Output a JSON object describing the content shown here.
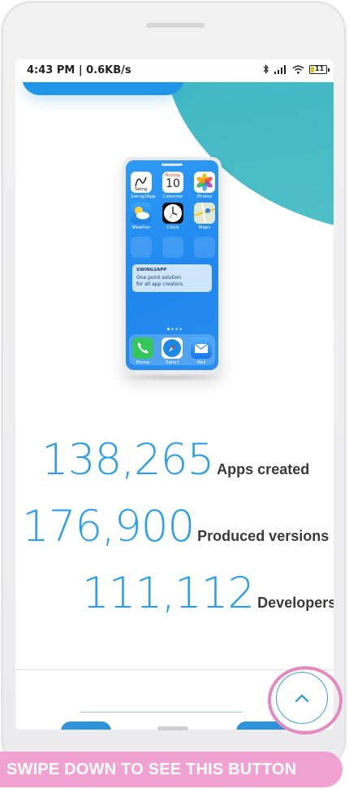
{
  "status_bar": {
    "time_speed": "4:43 PM | 0.6KB/s",
    "battery_level": "11"
  },
  "mini_phone": {
    "apps": [
      {
        "label": "Swing2App",
        "icon": "swing2app-icon"
      },
      {
        "label": "Calendar",
        "icon": "calendar-icon",
        "day": "Monday",
        "date": "10"
      },
      {
        "label": "Photos",
        "icon": "photos-icon"
      },
      {
        "label": "Weather",
        "icon": "weather-icon"
      },
      {
        "label": "Clock",
        "icon": "clock-icon"
      },
      {
        "label": "Maps",
        "icon": "maps-icon"
      }
    ],
    "widget": {
      "brand": "SWING2APP",
      "line1": "One point solution",
      "line2": "for all app creators."
    },
    "dock": [
      {
        "label": "Phone",
        "icon": "phone-icon"
      },
      {
        "label": "Safari",
        "icon": "safari-icon"
      },
      {
        "label": "Mail",
        "icon": "mail-icon"
      }
    ]
  },
  "stats": [
    {
      "value": "138,265",
      "caption": "Apps created"
    },
    {
      "value": "176,900",
      "caption": "Produced versions"
    },
    {
      "value": "111,112",
      "caption": "Developers"
    }
  ],
  "scroll_top_button": {
    "icon": "chevron-up-icon"
  },
  "banner": {
    "text": "SWIPE DOWN TO SEE THIS BUTTON"
  },
  "colors": {
    "accent_blue": "#2ba0ea",
    "teal": "#3fb8c4",
    "highlight_pink": "#e58ac0",
    "banner_pink": "#f0a3d3"
  }
}
